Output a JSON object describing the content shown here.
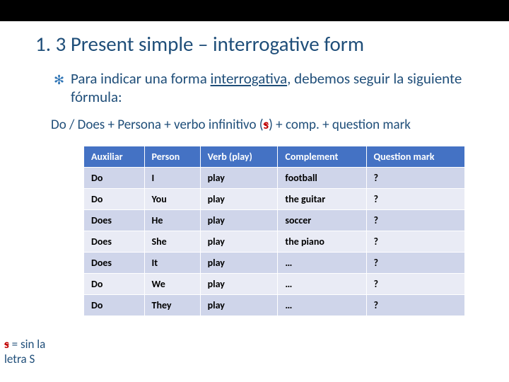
{
  "title": "1. 3 Present simple – interrogative form",
  "bullet": {
    "pre": "Para indicar una forma ",
    "under": "interrogativa",
    "post": ", debemos seguir la siguiente fórmula:"
  },
  "formula": {
    "pre": "Do / Does + Persona + verbo infinitivo (",
    "strike": "s",
    "post": ") + comp. + question mark"
  },
  "headers": [
    "Auxiliar",
    "Person",
    "Verb (play)",
    "Complement",
    "Question mark"
  ],
  "rows": [
    [
      "Do",
      "I",
      "play",
      "football",
      "?"
    ],
    [
      "Do",
      "You",
      "play",
      "the guitar",
      "?"
    ],
    [
      "Does",
      "He",
      "play",
      "soccer",
      "?"
    ],
    [
      "Does",
      "She",
      "play",
      "the piano",
      "?"
    ],
    [
      "Does",
      "It",
      "play",
      "…",
      "?"
    ],
    [
      "Do",
      "We",
      "play",
      "…",
      "?"
    ],
    [
      "Do",
      "They",
      "play",
      "…",
      "?"
    ]
  ],
  "footnote": {
    "strike": "s",
    "mid": " = sin la",
    "line2": "letra S"
  }
}
